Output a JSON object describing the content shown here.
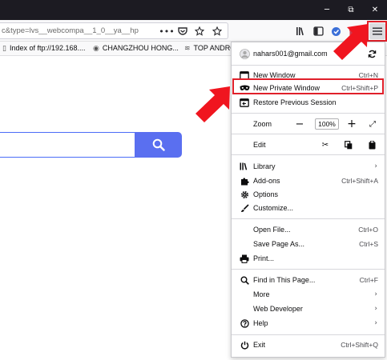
{
  "window": {
    "minimize": "─",
    "restore": "⧉",
    "close": "✕"
  },
  "urlbar": {
    "text": "c&type=lvs__webcompa__1_0__ya__hp",
    "more_icon": "dots-icon",
    "pocket_icon": "pocket-icon",
    "bookmark_icon": "star-icon"
  },
  "toolbar": {
    "library_icon": "library-icon",
    "sidebar_icon": "sidebar-icon",
    "extension_icon": "extension-icon",
    "gift_icon": "gift-icon",
    "menu_icon": "hamburger-icon"
  },
  "bookmarks": [
    {
      "label": "Index of ftp://192.168....",
      "icon": "page-icon"
    },
    {
      "label": "CHANGZHOU HONG...",
      "icon": "globe-icon"
    },
    {
      "label": "TOP ANDROI",
      "icon": "wifi-icon"
    }
  ],
  "search": {
    "value": "",
    "button_icon": "search-icon",
    "button_color": "#5a6ff0"
  },
  "menu": {
    "account": "nahars001@gmail.com",
    "items": {
      "new_window": {
        "label": "New Window",
        "shortcut": "Ctrl+N"
      },
      "new_private_window": {
        "label": "New Private Window",
        "shortcut": "Ctrl+Shift+P"
      },
      "restore_session": {
        "label": "Restore Previous Session"
      },
      "zoom": {
        "label": "Zoom",
        "minus": "−",
        "value": "100%",
        "plus": "+",
        "fullscreen": "⤢"
      },
      "edit": {
        "label": "Edit",
        "cut": "✂",
        "copy": "⎘",
        "paste": "⎙"
      },
      "library": {
        "label": "Library"
      },
      "addons": {
        "label": "Add-ons",
        "shortcut": "Ctrl+Shift+A"
      },
      "options": {
        "label": "Options"
      },
      "customize": {
        "label": "Customize..."
      },
      "open_file": {
        "label": "Open File...",
        "shortcut": "Ctrl+O"
      },
      "save_page": {
        "label": "Save Page As...",
        "shortcut": "Ctrl+S"
      },
      "print": {
        "label": "Print..."
      },
      "find": {
        "label": "Find in This Page...",
        "shortcut": "Ctrl+F"
      },
      "more": {
        "label": "More"
      },
      "web_developer": {
        "label": "Web Developer"
      },
      "help": {
        "label": "Help"
      },
      "exit": {
        "label": "Exit",
        "shortcut": "Ctrl+Shift+Q"
      }
    }
  },
  "annotations": {
    "highlight_color": "#e0202a"
  }
}
